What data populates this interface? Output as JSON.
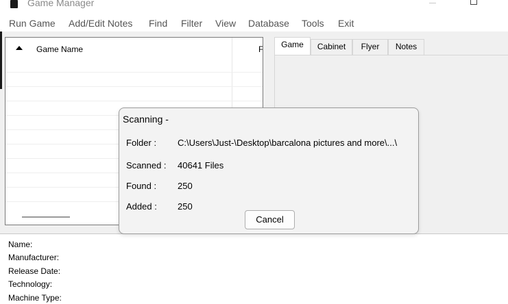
{
  "window": {
    "title": "Game Manager"
  },
  "menubar": {
    "items": [
      "Run Game",
      "Add/Edit Notes",
      "Find",
      "Filter",
      "View",
      "Database",
      "Tools",
      "Exit"
    ]
  },
  "game_list": {
    "column_header": "Game Name",
    "second_column_header": "F"
  },
  "tabs": {
    "items": [
      "Game",
      "Cabinet",
      "Flyer",
      "Notes"
    ],
    "active": "Game"
  },
  "info": {
    "name_label": "Name:",
    "manufacturer_label": "Manufacturer:",
    "release_date_label": "Release Date:",
    "technology_label": "Technology:",
    "machine_type_label": "Machine Type:"
  },
  "scan_dialog": {
    "title": "Scanning -",
    "folder_label": "Folder  :",
    "folder_value": "C:\\Users\\Just-\\Desktop\\barcalona pictures and more\\...\\",
    "scanned_label": "Scanned :",
    "scanned_value": "40641 Files",
    "found_label": "Found  :",
    "found_value": "250",
    "added_label": "Added  :",
    "added_value": "250",
    "cancel_label": "Cancel"
  }
}
